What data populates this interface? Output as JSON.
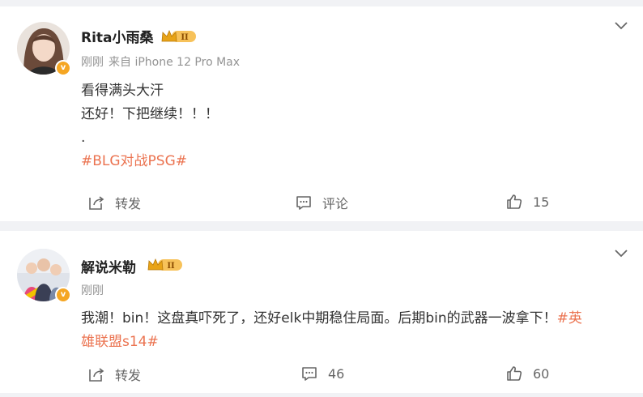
{
  "posts": [
    {
      "username": "Rita小雨桑",
      "level": "II",
      "time": "刚刚",
      "source": "来自 iPhone 12 Pro Max",
      "lines": [
        "看得满头大汗",
        "还好！下把继续！！！",
        "."
      ],
      "topic": "#BLG对战PSG#",
      "actions": {
        "repost": "转发",
        "comment": "评论",
        "like": "15"
      }
    },
    {
      "username": "解说米勒",
      "level": "II",
      "time": "刚刚",
      "text": "我潮！bin！这盘真吓死了，还好elk中期稳住局面。后期bin的武器一波拿下！",
      "topic_part1": "#英",
      "topic_part2": "雄联盟s14#",
      "actions": {
        "repost": "转发",
        "comment": "46",
        "like": "60"
      }
    }
  ],
  "colors": {
    "topic": "#eb7350",
    "badge": "#f5a623",
    "crown": "#e8a317"
  },
  "icons": [
    "chevron-down-icon",
    "repost-icon",
    "comment-icon",
    "like-icon",
    "crown-badge-icon",
    "verified-icon"
  ]
}
